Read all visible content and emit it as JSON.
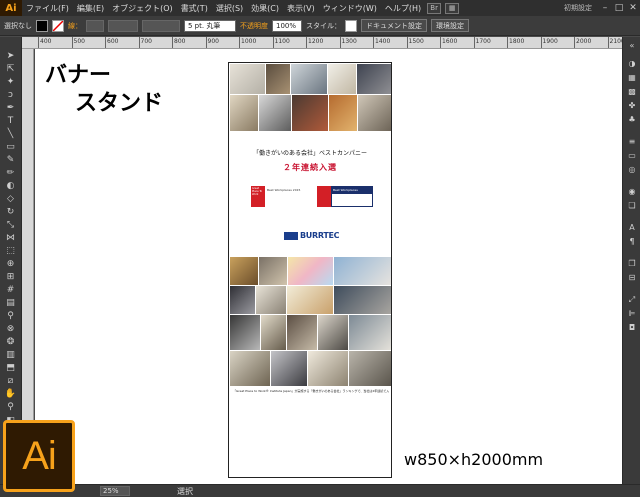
{
  "app": {
    "logo_small": "Ai",
    "logo_large": "Ai",
    "accent": "#f7a21b"
  },
  "menubar": {
    "items": [
      "ファイル(F)",
      "編集(E)",
      "オブジェクト(O)",
      "書式(T)",
      "選択(S)",
      "効果(C)",
      "表示(V)",
      "ウィンドウ(W)",
      "ヘルプ(H)"
    ],
    "preset": "初期設定"
  },
  "controlbar": {
    "selection": "選択なし",
    "stroke_label": "線：",
    "brush": "5 pt. 丸筆",
    "opacity_label": "不透明度",
    "opacity_value": "100%",
    "style_label": "スタイル：",
    "doc_settings": "ドキュメント設定",
    "env_settings": "環境設定"
  },
  "ruler": {
    "labels": [
      "400",
      "500",
      "600",
      "700",
      "800",
      "900",
      "1000",
      "1100",
      "1200",
      "1300",
      "1400",
      "1500",
      "1600",
      "1700",
      "1800",
      "1900",
      "2000",
      "2100"
    ]
  },
  "canvas": {
    "title_line1": "バナー",
    "title_line2": "スタンド",
    "dimension": "w850×h2000mm"
  },
  "banner": {
    "headline": "「働きがいのある会社」ベストカンパニー",
    "subhead": "２年連続入選",
    "logo1_text": "Great Place To Work",
    "logo1_sub": "Best Workplaces 2015",
    "logo2_text": "Best Workplaces",
    "company": "BURRTEC",
    "footnote": "「Great Place to Work® Institute Japan」が実施する「働きがいのある会社」ランキングで、当社は2年連続で入選しました。"
  },
  "statusbar": {
    "zoom": "25%",
    "mode": "選択"
  }
}
